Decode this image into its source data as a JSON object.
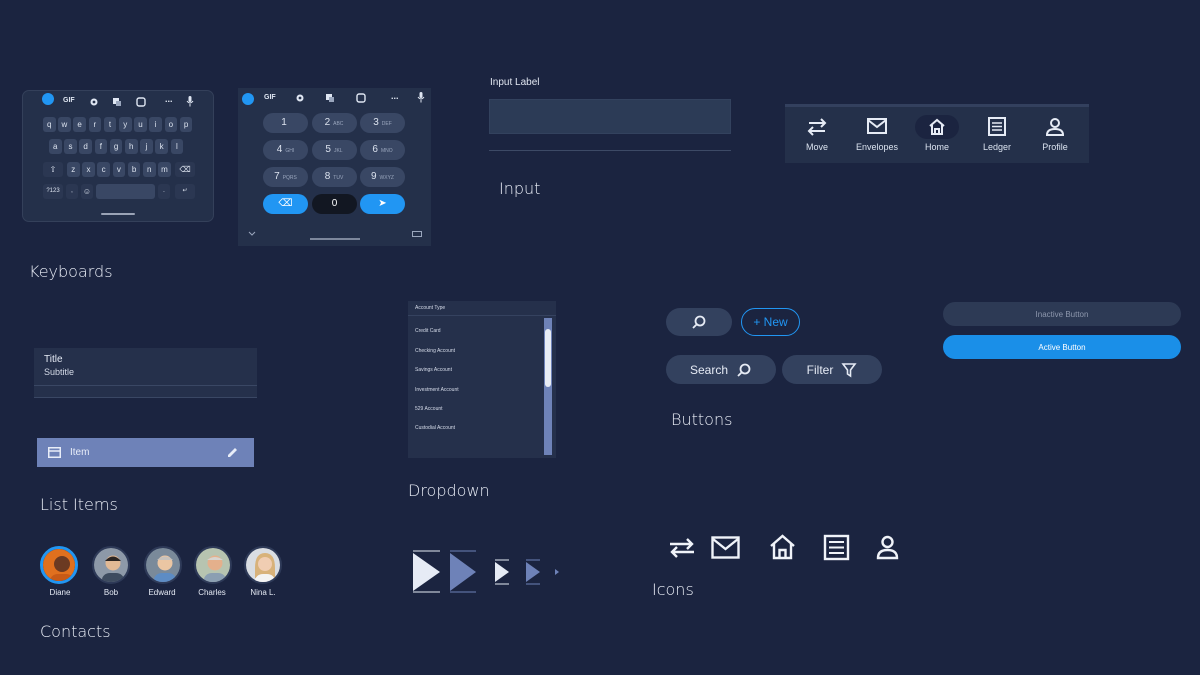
{
  "sections": {
    "keyboards": "Keyboards",
    "input": "Input",
    "list_items": "List Items",
    "dropdown": "Dropdown",
    "buttons": "Buttons",
    "contacts": "Contacts",
    "icons": "Icons"
  },
  "keyboard_alpha": {
    "toolbar": [
      "GIF",
      "..."
    ],
    "row1": [
      "q",
      "w",
      "e",
      "r",
      "t",
      "y",
      "u",
      "i",
      "o",
      "p"
    ],
    "row2": [
      "a",
      "s",
      "d",
      "f",
      "g",
      "h",
      "j",
      "k",
      "l"
    ],
    "row3": [
      "z",
      "x",
      "c",
      "v",
      "b",
      "n",
      "m"
    ],
    "bottom": [
      "?123",
      ",",
      ".",
      "↵"
    ]
  },
  "keyboard_numeric": {
    "toolbar": [
      "GIF",
      "..."
    ],
    "keys": [
      {
        "n": "1",
        "s": ""
      },
      {
        "n": "2",
        "s": "ABC"
      },
      {
        "n": "3",
        "s": "DEF"
      },
      {
        "n": "4",
        "s": "GHI"
      },
      {
        "n": "5",
        "s": "JKL"
      },
      {
        "n": "6",
        "s": "MNO"
      },
      {
        "n": "7",
        "s": "PQRS"
      },
      {
        "n": "8",
        "s": "TUV"
      },
      {
        "n": "9",
        "s": "WXYZ"
      }
    ],
    "zero": "0"
  },
  "input": {
    "label": "Input Label",
    "value": ""
  },
  "bottom_nav": {
    "items": [
      "Move",
      "Envelopes",
      "Home",
      "Ledger",
      "Profile"
    ],
    "active": "Home"
  },
  "list": {
    "title": "Title",
    "subtitle": "Subtitle",
    "item_label": "Item"
  },
  "dropdown": {
    "header": "Account Type",
    "options": [
      "Credit Card",
      "Checking Account",
      "Savings Account",
      "Investment Account",
      "529 Account",
      "Custodial Account"
    ]
  },
  "buttons": {
    "new_label": "+ New",
    "search_label": "Search",
    "filter_label": "Filter",
    "inactive_label": "Inactive Button",
    "active_label": "Active Button"
  },
  "contacts": [
    "Diane",
    "Bob",
    "Edward",
    "Charles",
    "Nina L."
  ],
  "colors": {
    "background": "#1b2440",
    "surface": "#24304a",
    "accent": "#2196f3",
    "list_selected": "#6e82b8"
  }
}
